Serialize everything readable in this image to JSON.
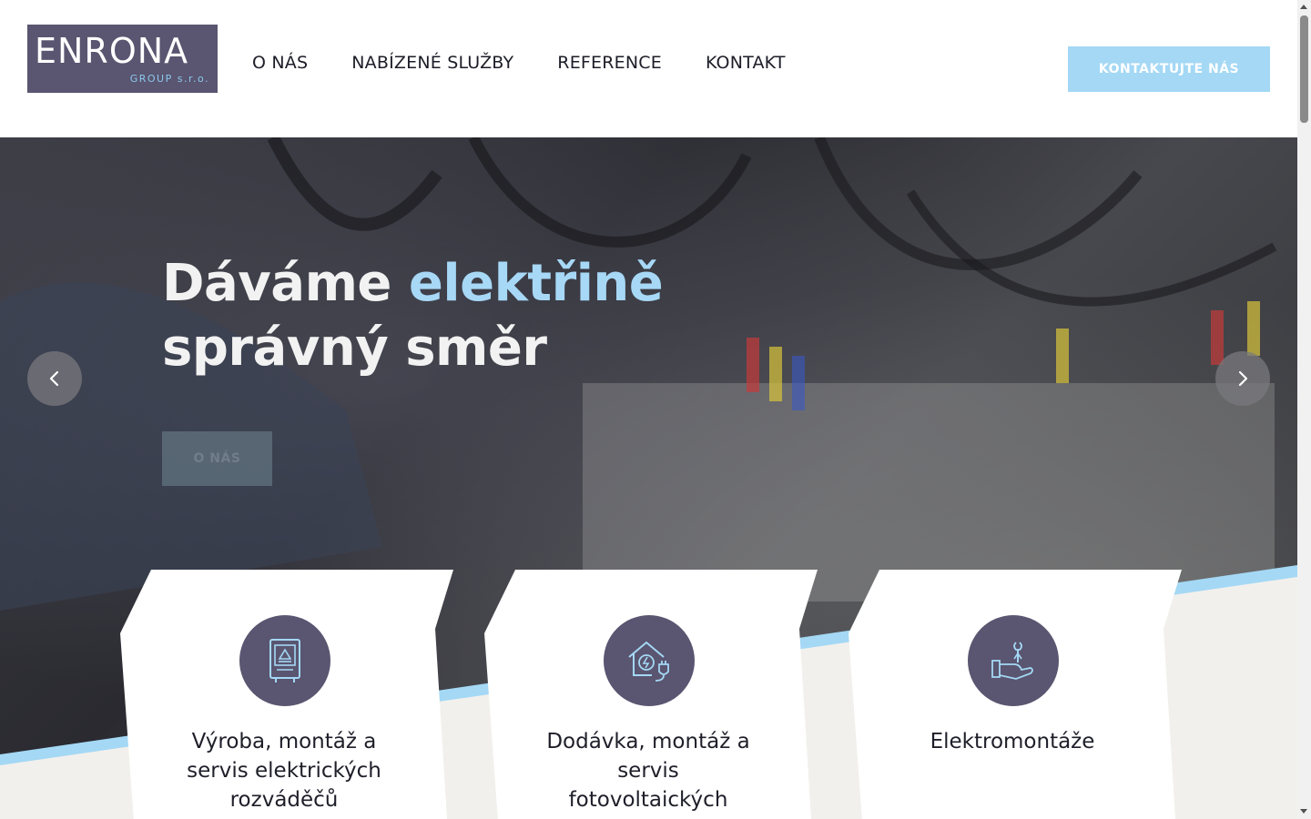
{
  "header": {
    "logo": {
      "wordmark": "ENRONA",
      "subtitle": "GROUP s.r.o."
    },
    "nav": [
      {
        "label": "O NÁS"
      },
      {
        "label": "NABÍZENÉ SLUŽBY"
      },
      {
        "label": "REFERENCE"
      },
      {
        "label": "KONTAKT"
      }
    ],
    "cta_label": "KONTAKTUJTE NÁS"
  },
  "hero": {
    "title_part1": "Dáváme ",
    "title_accent": "elektřině",
    "title_line2": "správný směr",
    "button_label": "O NÁS",
    "prev_icon": "chevron-left-icon",
    "next_icon": "chevron-right-icon"
  },
  "services": [
    {
      "title": "Výroba, montáž a servis elektrických rozváděčů",
      "icon": "switchboard-icon"
    },
    {
      "title": "Dodávka, montáž a servis fotovoltaických",
      "icon": "house-plug-icon"
    },
    {
      "title": "Elektromontáže",
      "icon": "hand-wrench-icon"
    }
  ],
  "colors": {
    "brand": "#5a5570",
    "accent": "#a4d8f5",
    "hero_accent_text": "#a7d8f6",
    "card_bg": "#ffffff",
    "floor": "#f2f0ec"
  }
}
